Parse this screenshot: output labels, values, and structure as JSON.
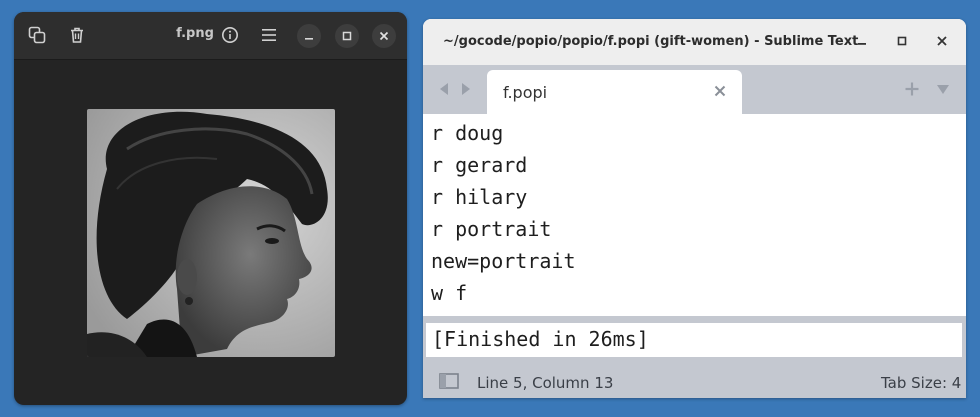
{
  "image_viewer": {
    "title": "f.png",
    "icons": [
      "copy-icon",
      "trash-icon",
      "info-icon",
      "hamburger-menu-icon",
      "minimize-icon",
      "maximize-icon",
      "close-icon"
    ],
    "colors": {
      "background": "#242424",
      "header": "#2e2e2e"
    }
  },
  "sublime": {
    "window_title": "~/gocode/popio/popio/f.popi (gift-women) - Sublime Text",
    "tab": {
      "label": "f.popi"
    },
    "editor_lines": [
      "r doug",
      "r gerard",
      "r hilary",
      "r portrait",
      "new=portrait",
      "w f"
    ],
    "output": "[Finished in 26ms]",
    "status": {
      "position": "Line 5, Column 13",
      "tab_size": "Tab Size: 4"
    },
    "colors": {
      "chrome": "#c4c8d0",
      "titlebar": "#eeeeee",
      "editor_bg": "#ffffff"
    }
  },
  "desktop": {
    "background": "#3a78b8"
  }
}
